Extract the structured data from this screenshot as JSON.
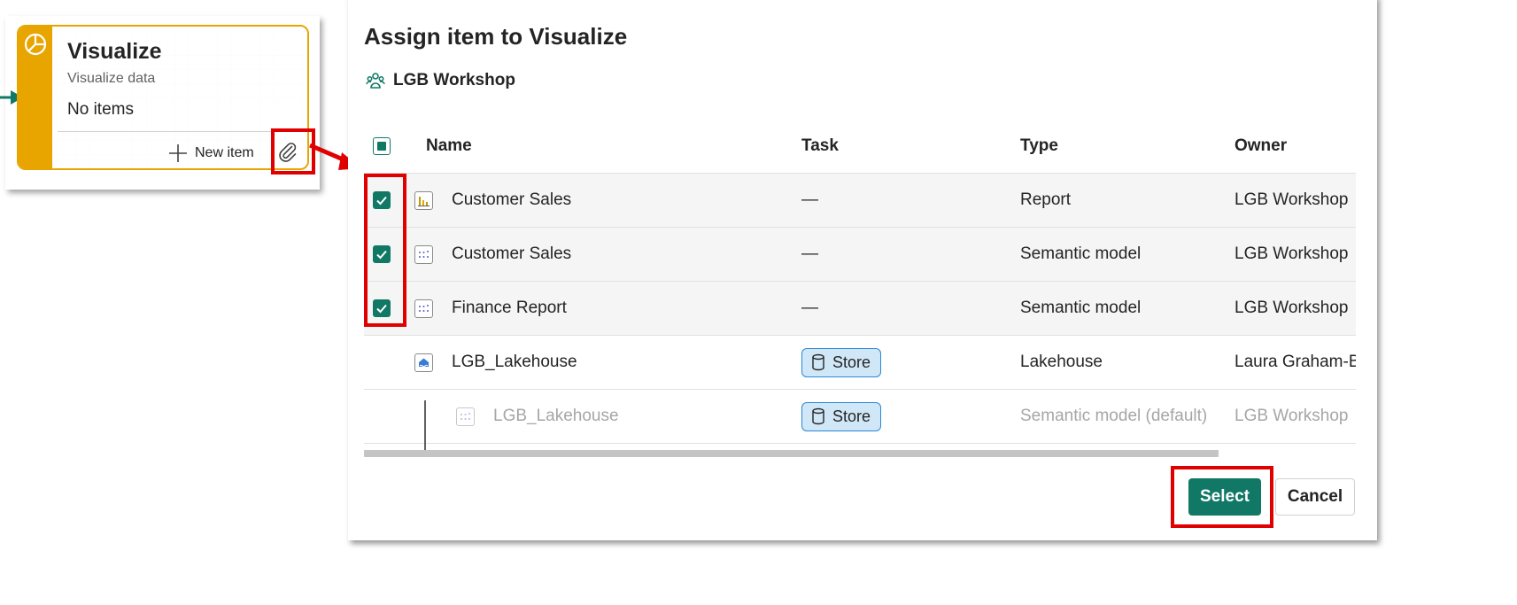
{
  "card": {
    "title": "Visualize",
    "subtitle": "Visualize data",
    "items_text": "No items",
    "new_item_label": "New item",
    "accent_color": "#e8a500"
  },
  "dialog": {
    "title": "Assign item to Visualize",
    "workspace": "LGB Workshop",
    "columns": {
      "name": "Name",
      "task": "Task",
      "type": "Type",
      "owner": "Owner"
    },
    "rows": [
      {
        "checked": true,
        "icon": "report-icon",
        "name": "Customer Sales",
        "task": "—",
        "type": "Report",
        "owner": "LGB Workshop"
      },
      {
        "checked": true,
        "icon": "semantic-model-icon",
        "name": "Customer Sales",
        "task": "—",
        "type": "Semantic model",
        "owner": "LGB Workshop"
      },
      {
        "checked": true,
        "icon": "semantic-model-icon",
        "name": "Finance Report",
        "task": "—",
        "type": "Semantic model",
        "owner": "LGB Workshop"
      },
      {
        "checked": false,
        "icon": "lakehouse-icon",
        "name": "LGB_Lakehouse",
        "task": "Store",
        "type": "Lakehouse",
        "owner": "Laura Graham-B"
      },
      {
        "checked": false,
        "icon": "semantic-model-icon",
        "name": "LGB_Lakehouse",
        "task": "Store",
        "type": "Semantic model (default)",
        "owner": "LGB Workshop",
        "child": true,
        "disabled": true
      }
    ],
    "select_label": "Select",
    "cancel_label": "Cancel",
    "accent_color": "#117865"
  },
  "annotation_color": "#e00000"
}
